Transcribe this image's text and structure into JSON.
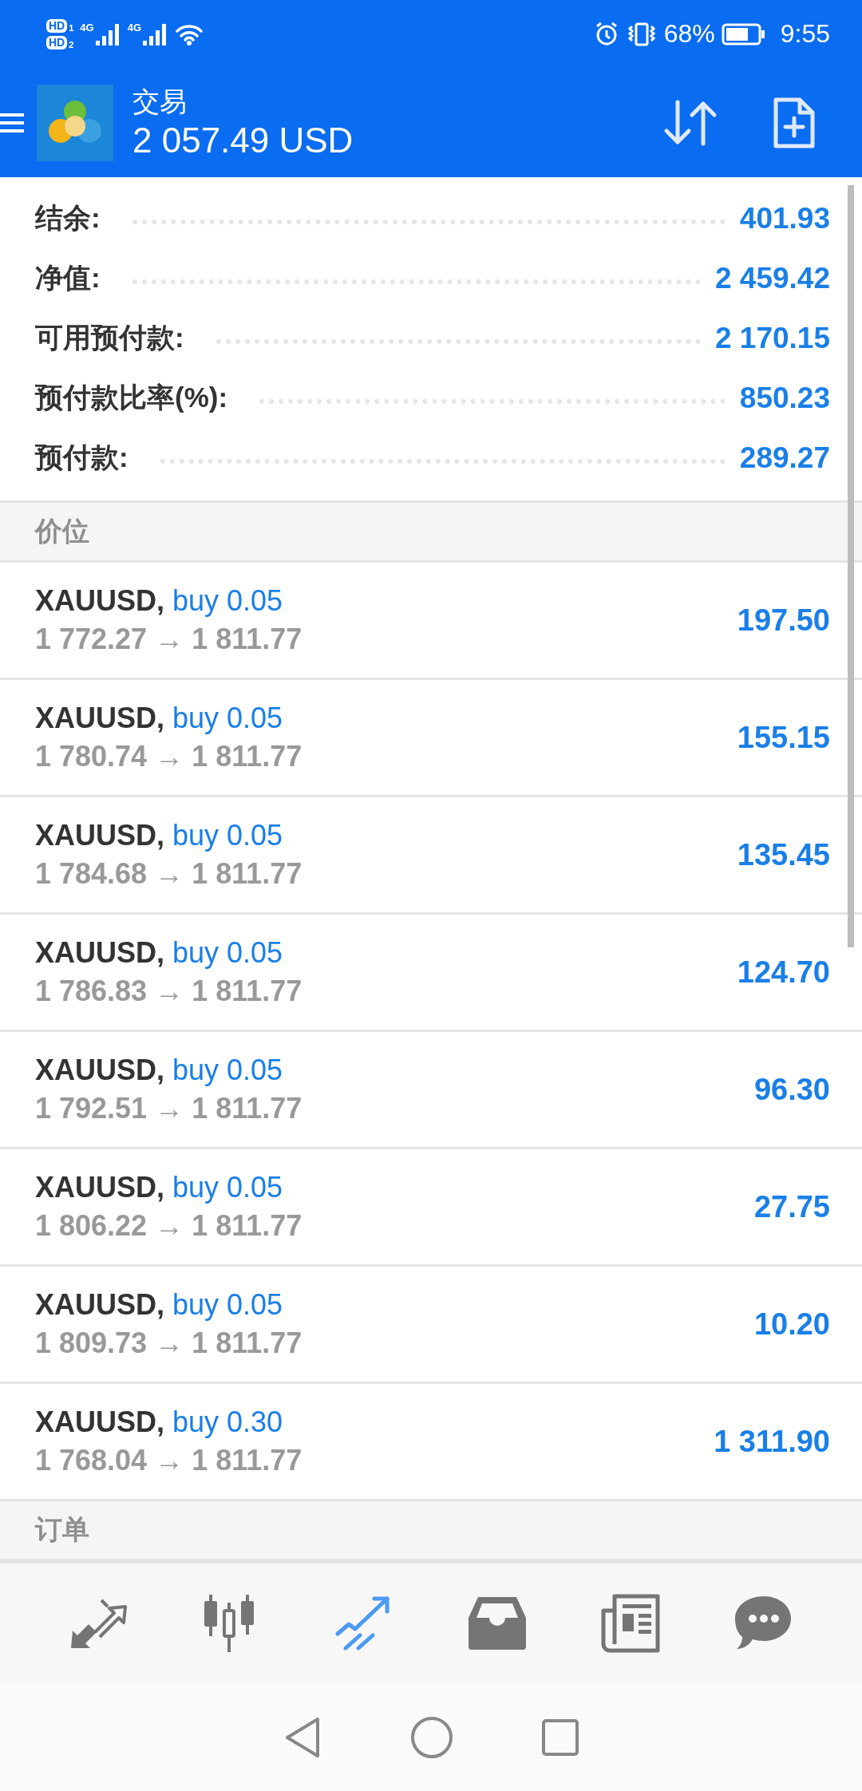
{
  "status_bar": {
    "sims": [
      {
        "badge": "HD",
        "slot": "1"
      },
      {
        "badge": "HD",
        "slot": "2"
      }
    ],
    "networks": [
      "4G",
      "4G"
    ],
    "battery": "68%",
    "time": "9:55"
  },
  "header": {
    "title": "交易",
    "balance": "2 057.49 USD"
  },
  "summary": [
    {
      "label": "结余:",
      "value": "401.93"
    },
    {
      "label": "净值:",
      "value": "2 459.42"
    },
    {
      "label": "可用预付款:",
      "value": "2 170.15"
    },
    {
      "label": "预付款比率(%):",
      "value": "850.23"
    },
    {
      "label": "预付款:",
      "value": "289.27"
    }
  ],
  "positions_section": "价位",
  "positions": [
    {
      "symbol": "XAUUSD,",
      "trade": "buy 0.05",
      "prices": "1 772.27 → 1 811.77",
      "profit": "197.50"
    },
    {
      "symbol": "XAUUSD,",
      "trade": "buy 0.05",
      "prices": "1 780.74 → 1 811.77",
      "profit": "155.15"
    },
    {
      "symbol": "XAUUSD,",
      "trade": "buy 0.05",
      "prices": "1 784.68 → 1 811.77",
      "profit": "135.45"
    },
    {
      "symbol": "XAUUSD,",
      "trade": "buy 0.05",
      "prices": "1 786.83 → 1 811.77",
      "profit": "124.70"
    },
    {
      "symbol": "XAUUSD,",
      "trade": "buy 0.05",
      "prices": "1 792.51 → 1 811.77",
      "profit": "96.30"
    },
    {
      "symbol": "XAUUSD,",
      "trade": "buy 0.05",
      "prices": "1 806.22 → 1 811.77",
      "profit": "27.75"
    },
    {
      "symbol": "XAUUSD,",
      "trade": "buy 0.05",
      "prices": "1 809.73 → 1 811.77",
      "profit": "10.20"
    },
    {
      "symbol": "XAUUSD,",
      "trade": "buy 0.30",
      "prices": "1 768.04 → 1 811.77",
      "profit": "1 311.90"
    }
  ],
  "orders_section": "订单",
  "bottom_nav": [
    {
      "kind": "quotes",
      "selected": false
    },
    {
      "kind": "chart",
      "selected": false
    },
    {
      "kind": "trade",
      "selected": true
    },
    {
      "kind": "history",
      "selected": false
    },
    {
      "kind": "news",
      "selected": false
    },
    {
      "kind": "chat",
      "selected": false
    }
  ]
}
